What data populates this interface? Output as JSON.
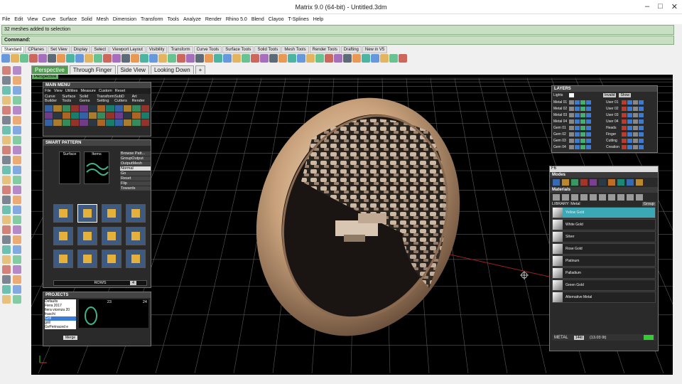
{
  "window": {
    "title": "Matrix 9.0 (64-bit) - Untitled.3dm"
  },
  "menu": [
    "File",
    "Edit",
    "View",
    "Curve",
    "Surface",
    "Solid",
    "Mesh",
    "Dimension",
    "Transform",
    "Tools",
    "Analyze",
    "Render",
    "Rhino 5.0",
    "Blend",
    "Clayoo",
    "T-Splines",
    "Help"
  ],
  "command": {
    "history": "32 meshes added to selection",
    "prompt": "Command:"
  },
  "toolbar_tabs": [
    "Standard",
    "CPlanes",
    "Set View",
    "Display",
    "Select",
    "Viewport Layout",
    "Visibility",
    "Transform",
    "Curve Tools",
    "Surface Tools",
    "Solid Tools",
    "Mesh Tools",
    "Render Tools",
    "Drafting",
    "New in V5"
  ],
  "viewport_tabs": [
    "Perspective",
    "Through Finger",
    "Side View",
    "Looking Down"
  ],
  "viewport_label": "Perspective",
  "main_menu": {
    "title": "MAIN MENU",
    "items": [
      "File",
      "View",
      "Utilities",
      "Measure",
      "Custom",
      "Reset"
    ],
    "subitems": [
      "Curve",
      "Surface",
      "Solid",
      "Transform",
      "SubD",
      "Art",
      "Builder",
      "Tools",
      "Gems",
      "Setting",
      "Cutters",
      "Render"
    ]
  },
  "smart_pattern": {
    "title": "SMART PATTERN",
    "slots": [
      "Surface",
      "Items"
    ],
    "options": [
      "Browse Patt...",
      "GroupOutput",
      "OutputMesh",
      "Normal",
      "Go",
      "Reset",
      "Flip",
      "Towards"
    ],
    "rows_label": "ROWS",
    "rows_value": "4"
  },
  "projects": {
    "title": "PROJECTS",
    "items": [
      "Defaults",
      "Fiera 2017",
      "fiera vicenza 20",
      "fraschi",
      "Grill",
      "grill",
      "GvPerinaced e"
    ],
    "counts": [
      "23",
      "24"
    ],
    "merge": "Merge"
  },
  "layers": {
    "title": "LAYERS",
    "lights": "Lights",
    "left": [
      "Metal 01",
      "Metal 02",
      "Metal 03",
      "Metal 04",
      "Gem 01",
      "Gem 02",
      "Gem 03",
      "Gem 04"
    ],
    "right": [
      "User 01",
      "User 02",
      "User 03",
      "User 04",
      "Heads",
      "Finger",
      "Cutting",
      "Creation"
    ],
    "buttons": [
      "Invalid",
      "Show"
    ]
  },
  "materials": {
    "f6": "F6",
    "modes": "Modes",
    "materials": "Materials",
    "library": "LIBRARY: Metal",
    "group": "Group",
    "items": [
      "Yellow Gold",
      "White Gold",
      "Silver",
      "Rose Gold",
      "Platinum",
      "Palladium",
      "Green Gold",
      "Alternative Metal"
    ],
    "footer_label": "METAL",
    "footer_value": "14kt",
    "footer_detail": "(13.03 0t)"
  }
}
